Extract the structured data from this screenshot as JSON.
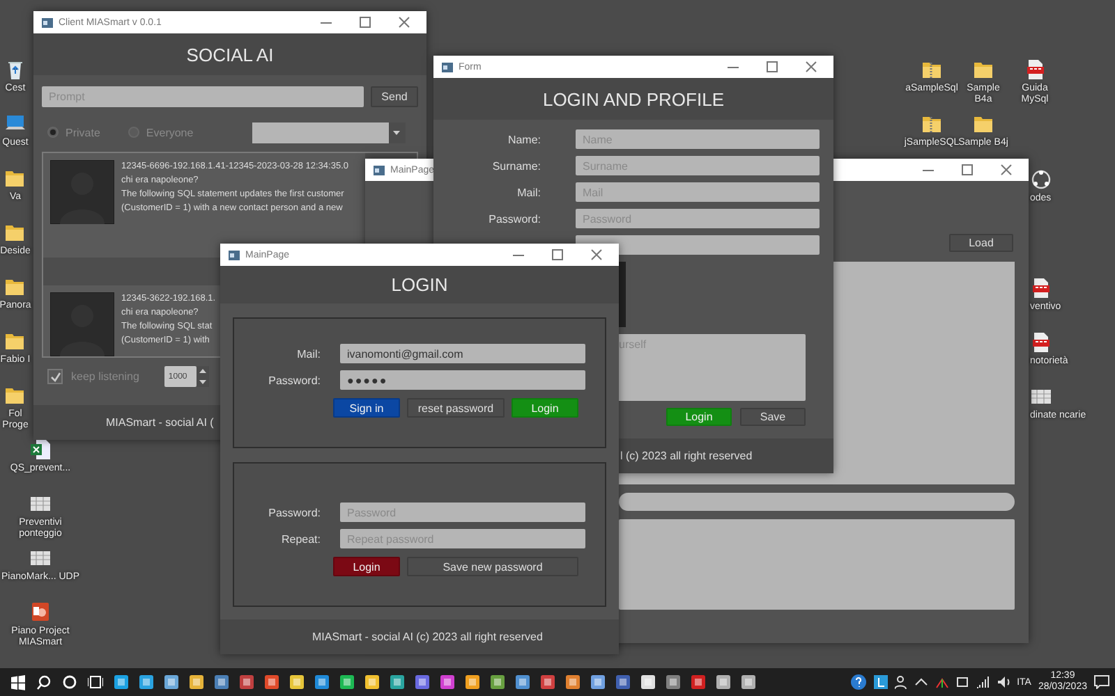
{
  "desktop": {
    "left_icons_partial": [
      {
        "label": "Cest",
        "kind": "recycle"
      },
      {
        "label": "Quest",
        "kind": "pc"
      },
      {
        "label": "Va",
        "kind": "folder"
      },
      {
        "label": "Deside",
        "kind": "folder"
      },
      {
        "label": "Panora",
        "kind": "folder"
      },
      {
        "label": "Fabio I",
        "kind": "folder"
      },
      {
        "label": "Fol Proge",
        "kind": "folder"
      }
    ],
    "left_icons": [
      {
        "label": "QS_prevent...",
        "kind": "excel"
      },
      {
        "label": "Preventivi ponteggio",
        "kind": "sheet"
      },
      {
        "label": "PianoMark... UDP",
        "kind": "sheet"
      },
      {
        "label": "Piano Project MIASmart",
        "kind": "ppt"
      }
    ],
    "right_icons": [
      {
        "label": "aSampleSql",
        "kind": "zip"
      },
      {
        "label": "Sample B4a",
        "kind": "folder"
      },
      {
        "label": "Guida MySql",
        "kind": "pdf"
      },
      {
        "label": "jSampleSQL",
        "kind": "zip"
      },
      {
        "label": "Sample B4j",
        "kind": "folder"
      }
    ],
    "right_icons_partial": [
      {
        "label": "odes",
        "kind": "network"
      },
      {
        "label": "ventivo",
        "kind": "pdf"
      },
      {
        "label": "notorietà",
        "kind": "pdf"
      },
      {
        "label": "dinate ncarie",
        "kind": "sheet"
      }
    ]
  },
  "social_window": {
    "title": "Client MIASmart v 0.0.1",
    "heading": "SOCIAL AI",
    "prompt": {
      "placeholder": "Prompt"
    },
    "send_button": "Send",
    "radios": [
      {
        "label": "Private",
        "selected": true
      },
      {
        "label": "Everyone",
        "selected": false
      }
    ],
    "messages": [
      {
        "header": "12345-6696-192.168.1.41-12345-2023-03-28 12:34:35.0",
        "question": "chi era napoleone?",
        "answer_lines": [
          "The following SQL statement updates the first customer",
          "(CustomerID = 1) with a new contact person and a new"
        ]
      },
      {
        "header": "12345-3622-192.168.1.",
        "question": "chi era napoleone?",
        "answer_lines": [
          "The following SQL stat",
          "(CustomerID = 1) with"
        ]
      }
    ],
    "keep_listening": {
      "label": "keep listening",
      "checked": true
    },
    "interval": {
      "value": "1000"
    },
    "footer": "MIASmart - social AI ("
  },
  "back_main_window": {
    "title": "MainPage",
    "load_button": "Load"
  },
  "form_window": {
    "title": "Form",
    "heading": "LOGIN AND PROFILE",
    "fields": [
      {
        "label": "Name:",
        "placeholder": "Name",
        "kind": "text"
      },
      {
        "label": "Surname:",
        "placeholder": "Surname",
        "kind": "text"
      },
      {
        "label": "Mail:",
        "placeholder": "Mail",
        "kind": "text"
      },
      {
        "label": "Password:",
        "placeholder": "Password",
        "kind": "text"
      },
      {
        "kind": "text"
      }
    ],
    "about": {
      "placeholder": "urself"
    },
    "buttons": [
      {
        "label": "Login",
        "kind": "success"
      },
      {
        "label": "Save",
        "kind": "default"
      }
    ],
    "footer": "l (c) 2023 all right reserved"
  },
  "front_main_window": {
    "title": "MainPage",
    "heading": "LOGIN",
    "login_panel": {
      "fields": [
        {
          "label": "Mail:",
          "value": "ivanomonti@gmail.com",
          "kind": "text"
        },
        {
          "label": "Password:",
          "value": "●●●●●",
          "kind": "password"
        }
      ],
      "buttons": [
        {
          "label": "Sign in",
          "kind": "primary"
        },
        {
          "label": "reset password",
          "kind": "default"
        },
        {
          "label": "Login",
          "kind": "success"
        }
      ]
    },
    "password_panel": {
      "fields": [
        {
          "label": "Password:",
          "placeholder": "Password"
        },
        {
          "label": "Repeat:",
          "placeholder": "Repeat password"
        }
      ],
      "buttons": [
        {
          "label": "Login",
          "kind": "danger"
        },
        {
          "label": "Save new password",
          "kind": "default"
        }
      ]
    },
    "footer": "MIASmart - social AI (c) 2023 all right reserved"
  },
  "taskbar": {
    "language": "ITA",
    "time": "12:39",
    "date": "28/03/2023"
  }
}
